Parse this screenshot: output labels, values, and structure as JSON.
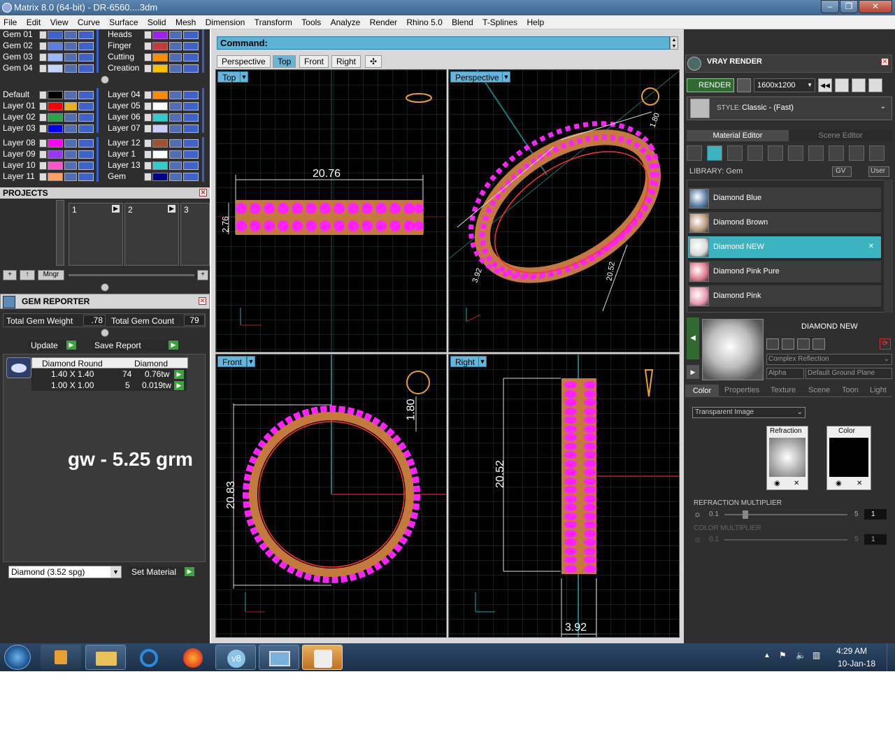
{
  "window": {
    "title": "Matrix 8.0 (64-bit) - DR-6560....3dm",
    "minimize": "‒",
    "maximize": "❐",
    "close": "✕"
  },
  "menu": [
    "File",
    "Edit",
    "View",
    "Curve",
    "Surface",
    "Solid",
    "Mesh",
    "Dimension",
    "Transform",
    "Tools",
    "Analyze",
    "Render",
    "Rhino 5.0",
    "Blend",
    "T-Splines",
    "Help"
  ],
  "layers": {
    "left_col": [
      {
        "name": "Gem 01",
        "color": "#3d62c9"
      },
      {
        "name": "Gem 02",
        "color": "#5a7fe0"
      },
      {
        "name": "Gem 03",
        "color": "#9ab8ff"
      },
      {
        "name": "Gem 04",
        "color": "#c3d6ff"
      },
      {
        "name": "Default",
        "color": "#000000"
      },
      {
        "name": "Layer 01",
        "color": "#ff0000"
      },
      {
        "name": "Layer 02",
        "color": "#2aa34a"
      },
      {
        "name": "Layer 03",
        "color": "#0000ff"
      },
      {
        "name": "Layer 08",
        "color": "#ff00ff"
      },
      {
        "name": "Layer 09",
        "color": "#9933ff"
      },
      {
        "name": "Layer 10",
        "color": "#ff55cc"
      },
      {
        "name": "Layer 11",
        "color": "#ffa060"
      }
    ],
    "right_col": [
      {
        "name": "Heads",
        "color": "#a020f0"
      },
      {
        "name": "Finger",
        "color": "#c23a3a"
      },
      {
        "name": "Cutting",
        "color": "#ff8c00"
      },
      {
        "name": "Creation",
        "color": "#ffbf00"
      },
      {
        "name": "Layer 04",
        "color": "#ff8c00"
      },
      {
        "name": "Layer 05",
        "color": "#ffffff"
      },
      {
        "name": "Layer 06",
        "color": "#33cccc"
      },
      {
        "name": "Layer 07",
        "color": "#ccccff"
      },
      {
        "name": "Layer 12",
        "color": "#a0522d"
      },
      {
        "name": "Layer 1",
        "color": "#ffffff"
      },
      {
        "name": "Layer 13",
        "color": "#33cccc"
      },
      {
        "name": "Gem",
        "color": "#00008b"
      }
    ]
  },
  "projects": {
    "title": "PROJECTS",
    "slots": [
      "1",
      "2",
      "3"
    ],
    "mngr": "Mngr"
  },
  "gem_reporter": {
    "title": "GEM REPORTER",
    "total_weight_label": "Total Gem Weight",
    "total_weight_value": ".78",
    "total_count_label": "Total Gem Count",
    "total_count_value": "79",
    "update": "Update",
    "save_report": "Save Report",
    "table_headers": [
      "Diamond Round",
      "Diamond"
    ],
    "rows": [
      {
        "size": "1.40 X 1.40",
        "count": "74",
        "tw": "0.76tw"
      },
      {
        "size": "1.00 X 1.00",
        "count": "5",
        "tw": "0.019tw"
      }
    ],
    "note": "gw - 5.25 grm",
    "material_select": "Diamond    (3.52 spg)",
    "set_material": "Set Material"
  },
  "command": {
    "label": "Command:"
  },
  "view_tabs": [
    "Perspective",
    "Top",
    "Front",
    "Right",
    "✣"
  ],
  "viewports": {
    "top": {
      "label": "Top",
      "dim": "20.76",
      "dim2": "2.76"
    },
    "perspective": {
      "label": "Perspective",
      "dim": "1.80",
      "dim2": "3.92",
      "dim3": "20.52"
    },
    "front": {
      "label": "Front",
      "dim": "20.83",
      "dim2": "1.80"
    },
    "right": {
      "label": "Right",
      "dim": "20.52",
      "dim2": "3.92"
    }
  },
  "vray": {
    "title": "VRAY RENDER",
    "render": "RENDER",
    "resolution": "1600x1200",
    "style_label": "STYLE:",
    "style_value": "Classic - (Fast)",
    "tab_material": "Material Editor",
    "tab_scene": "Scene Editor",
    "library": "LIBRARY: Gem",
    "gv": "GV",
    "user": "User",
    "materials": [
      {
        "name": "Diamond Blue",
        "color": "#5a7fa8"
      },
      {
        "name": "Diamond Brown",
        "color": "#b89a7a"
      },
      {
        "name": "Diamond NEW",
        "color": "#d9d9d9"
      },
      {
        "name": "Diamond Pink Pure",
        "color": "#e07b8d"
      },
      {
        "name": "Diamond Pink",
        "color": "#e899b0"
      }
    ],
    "selected_title": "DIAMOND NEW",
    "reflection": "Complex Reflection",
    "alpha": "Alpha",
    "ground": "Default Ground Plane",
    "subtabs": [
      "Color",
      "Properties",
      "Texture",
      "Scene",
      "Toon",
      "Light"
    ],
    "transparent": "Transparent Image",
    "refraction_label": "Refraction",
    "color_label": "Color",
    "refraction_mult": "REFRACTION MULTIPLIER",
    "color_mult": "COLOR MULTIPLIER",
    "mult_min": "0.1",
    "mult_max": "5",
    "mult_val": "1"
  },
  "taskbar": {
    "time": "4:29 AM",
    "date": "10-Jan-18"
  }
}
